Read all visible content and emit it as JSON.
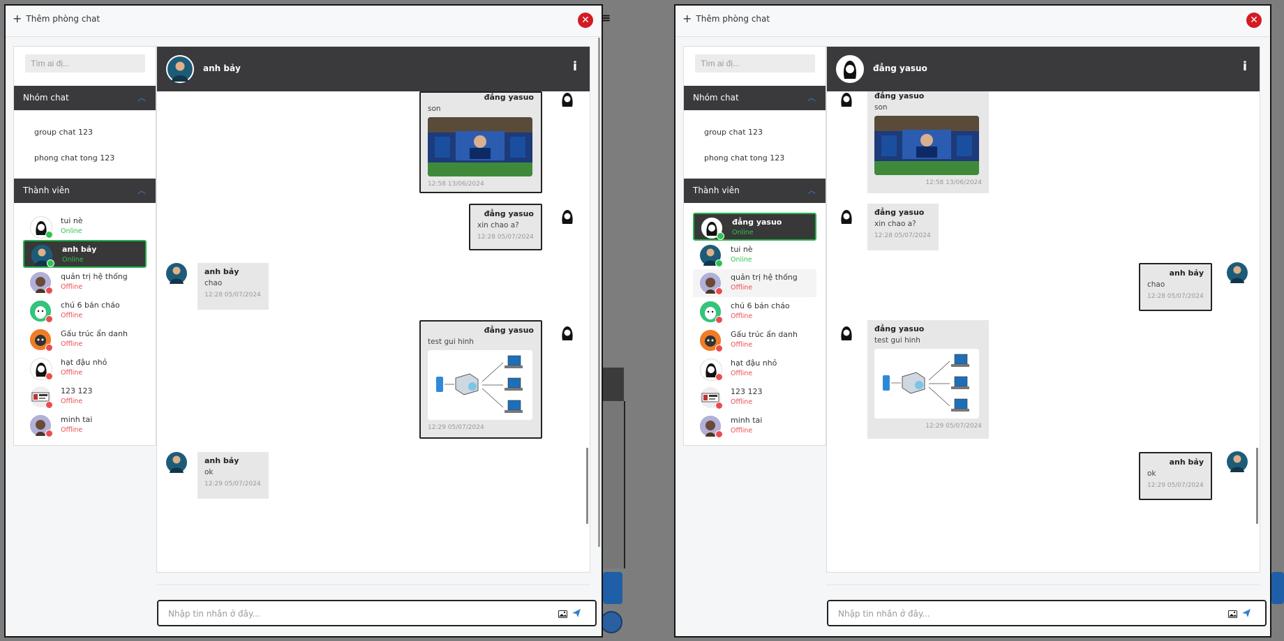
{
  "colors": {
    "header_dark": "#3a3a3c",
    "online": "#2ec24e",
    "offline": "#ea4d4d",
    "close": "#d31b23",
    "accent": "#3a7bd5"
  },
  "windows": [
    {
      "add_room": "Thêm phòng chat",
      "search_placeholder": "Tìm ai đị...",
      "groups_title": "Nhóm chat",
      "groups": [
        "group chat 123",
        "phong chat tong 123"
      ],
      "members_title": "Thành viên",
      "members": [
        {
          "name": "tui nè",
          "status": "Online"
        },
        {
          "name": "anh bảy",
          "status": "Online"
        },
        {
          "name": "quản trị hệ thống",
          "status": "Offline"
        },
        {
          "name": "chú 6 bán cháo",
          "status": "Offline"
        },
        {
          "name": "Gấu trúc ẩn danh",
          "status": "Offline"
        },
        {
          "name": "hạt đậu nhỏ",
          "status": "Offline"
        },
        {
          "name": "123 123",
          "status": "Offline"
        },
        {
          "name": "minh tai",
          "status": "Offline"
        }
      ],
      "chat_name": "anh bảy",
      "info": "i",
      "messages": [
        {
          "sender": "đẳng yasuo",
          "text": "son",
          "time": "12:58 13/06/2024"
        },
        {
          "sender": "đẳng yasuo",
          "text": "xin chao a?",
          "time": "12:28 05/07/2024"
        },
        {
          "sender": "anh bảy",
          "text": "chao",
          "time": "12:28 05/07/2024"
        },
        {
          "sender": "đẳng yasuo",
          "text": "test gui hinh",
          "time": "12:29 05/07/2024"
        },
        {
          "sender": "anh bảy",
          "text": "ok",
          "time": "12:29 05/07/2024"
        }
      ],
      "input_placeholder": "Nhập tin nhắn ở đây..."
    },
    {
      "add_room": "Thêm phòng chat",
      "search_placeholder": "Tìm ai đị...",
      "groups_title": "Nhóm chat",
      "groups": [
        "group chat 123",
        "phong chat tong 123"
      ],
      "members_title": "Thành viên",
      "members": [
        {
          "name": "đẳng yasuo",
          "status": "Online"
        },
        {
          "name": "tui nè",
          "status": "Online"
        },
        {
          "name": "quản trị hệ thống",
          "status": "Offline"
        },
        {
          "name": "chú 6 bán cháo",
          "status": "Offline"
        },
        {
          "name": "Gấu trúc ẩn danh",
          "status": "Offline"
        },
        {
          "name": "hạt đậu nhỏ",
          "status": "Offline"
        },
        {
          "name": "123 123",
          "status": "Offline"
        },
        {
          "name": "minh tai",
          "status": "Offline"
        }
      ],
      "chat_name": "đẳng yasuo",
      "info": "i",
      "messages": [
        {
          "sender": "đẳng yasuo",
          "text": "son",
          "time": "12:58 13/06/2024"
        },
        {
          "sender": "đẳng yasuo",
          "text": "xin chao a?",
          "time": "12:28 05/07/2024"
        },
        {
          "sender": "anh bảy",
          "text": "chao",
          "time": "12:28 05/07/2024"
        },
        {
          "sender": "đẳng yasuo",
          "text": "test gui hinh",
          "time": "12:29 05/07/2024"
        },
        {
          "sender": "anh bảy",
          "text": "ok",
          "time": "12:29 05/07/2024"
        }
      ],
      "input_placeholder": "Nhập tin nhắn ở đây..."
    }
  ]
}
